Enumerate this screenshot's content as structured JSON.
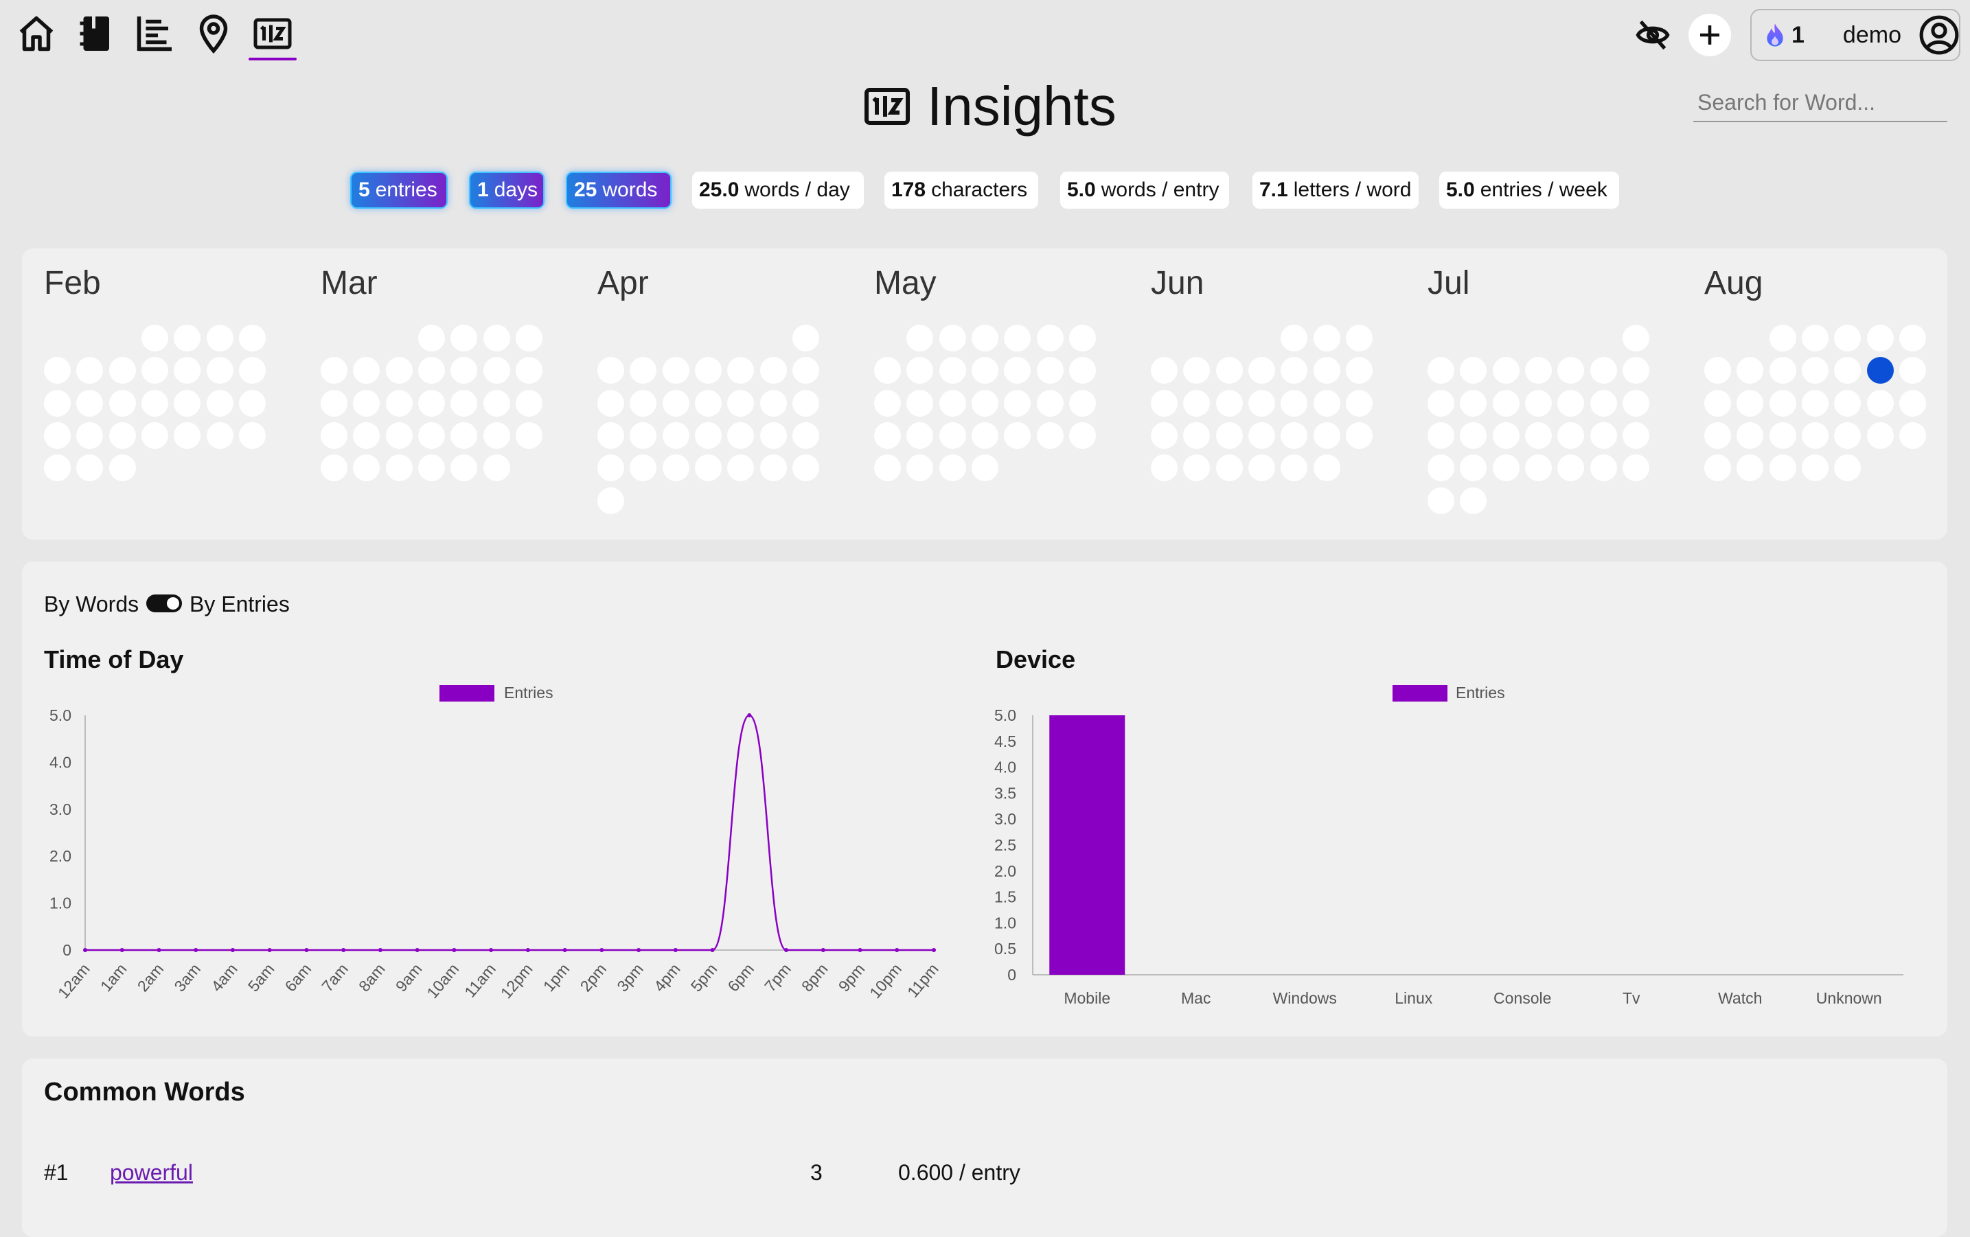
{
  "nav": {
    "items": [
      {
        "name": "home-icon"
      },
      {
        "name": "journal-icon"
      },
      {
        "name": "timeline-icon"
      },
      {
        "name": "map-pin-icon"
      },
      {
        "name": "insights-icon"
      }
    ],
    "active": "insights-icon"
  },
  "header": {
    "streak_count": "1",
    "username": "demo"
  },
  "page": {
    "title": "Insights",
    "search_placeholder": "Search for Word..."
  },
  "stats": [
    {
      "value": "5",
      "unit": "entries",
      "style": "grad"
    },
    {
      "value": "1",
      "unit": "days",
      "style": "grad"
    },
    {
      "value": "25",
      "unit": "words",
      "style": "grad"
    },
    {
      "value": "25.0",
      "unit": "words / day",
      "style": "white"
    },
    {
      "value": "178",
      "unit": "characters",
      "style": "white"
    },
    {
      "value": "5.0",
      "unit": "words / entry",
      "style": "white"
    },
    {
      "value": "7.1",
      "unit": "letters / word",
      "style": "white"
    },
    {
      "value": "5.0",
      "unit": "entries / week",
      "style": "white"
    }
  ],
  "calendar": {
    "months": [
      "Feb",
      "Mar",
      "Apr",
      "May",
      "Jun",
      "Jul",
      "Aug"
    ],
    "active_color": "#0b4fd6"
  },
  "toggle": {
    "left_label": "By Words",
    "right_label": "By Entries",
    "state": "By Entries"
  },
  "charts_meta": {
    "accent": "#8a00c2"
  },
  "chart_data": [
    {
      "type": "line",
      "title": "Time of Day",
      "series": [
        {
          "name": "Entries",
          "values": [
            0,
            0,
            0,
            0,
            0,
            0,
            0,
            0,
            0,
            0,
            0,
            0,
            0,
            0,
            0,
            0,
            0,
            0,
            5,
            0,
            0,
            0,
            0,
            0
          ]
        }
      ],
      "categories": [
        "12am",
        "1am",
        "2am",
        "3am",
        "4am",
        "5am",
        "6am",
        "7am",
        "8am",
        "9am",
        "10am",
        "11am",
        "12pm",
        "1pm",
        "2pm",
        "3pm",
        "4pm",
        "5pm",
        "6pm",
        "7pm",
        "8pm",
        "9pm",
        "10pm",
        "11pm"
      ],
      "ylim": [
        0,
        5
      ],
      "yticks": [
        "0",
        "1.0",
        "2.0",
        "3.0",
        "4.0",
        "5.0"
      ],
      "legend": "top-center"
    },
    {
      "type": "bar",
      "title": "Device",
      "series": [
        {
          "name": "Entries",
          "values": [
            5,
            0,
            0,
            0,
            0,
            0,
            0,
            0
          ]
        }
      ],
      "categories": [
        "Mobile",
        "Mac",
        "Windows",
        "Linux",
        "Console",
        "Tv",
        "Watch",
        "Unknown"
      ],
      "ylim": [
        0,
        5
      ],
      "yticks": [
        "0",
        "0.5",
        "1.0",
        "1.5",
        "2.0",
        "2.5",
        "3.0",
        "3.5",
        "4.0",
        "4.5",
        "5.0"
      ],
      "legend": "top-center"
    }
  ],
  "common_words": {
    "title": "Common Words",
    "rows": [
      {
        "rank": "#1",
        "word": "powerful",
        "count": "3",
        "rate": "0.600 / entry"
      }
    ]
  }
}
